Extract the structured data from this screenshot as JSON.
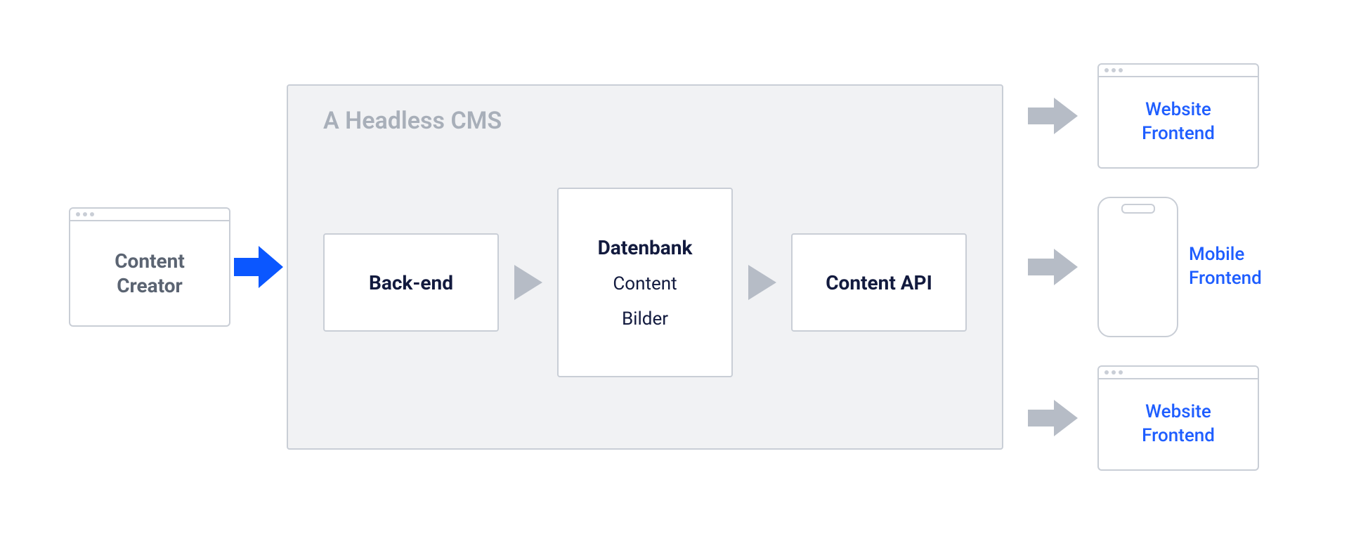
{
  "creator": {
    "label": "Content\nCreator"
  },
  "cms": {
    "title": "A Headless CMS",
    "backend": {
      "label": "Back-end"
    },
    "database": {
      "title": "Datenbank",
      "items": [
        "Content",
        "Bilder"
      ]
    },
    "api": {
      "label": "Content API"
    }
  },
  "outputs": {
    "website1": "Website\nFrontend",
    "mobile": "Mobile\nFrontend",
    "website2": "Website\nFrontend"
  },
  "colors": {
    "accent_blue": "#1f5eff",
    "arrow_blue": "#0b57ff",
    "arrow_grey": "#b6bcc6",
    "text_dark": "#121a3e",
    "text_muted": "#a8afb9",
    "border": "#c9ced6",
    "container_bg": "#f1f2f4"
  }
}
